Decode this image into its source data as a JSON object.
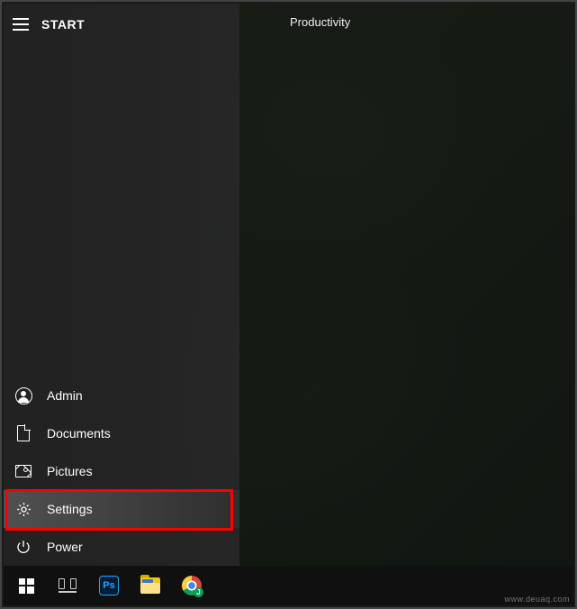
{
  "start": {
    "header": "START",
    "items": [
      {
        "label": "Admin",
        "icon": "user-icon"
      },
      {
        "label": "Documents",
        "icon": "document-icon"
      },
      {
        "label": "Pictures",
        "icon": "pictures-icon"
      },
      {
        "label": "Settings",
        "icon": "gear-icon"
      },
      {
        "label": "Power",
        "icon": "power-icon"
      }
    ],
    "highlighted_index": 3,
    "group_title": "Productivity"
  },
  "taskbar": {
    "items": [
      {
        "name": "start-button",
        "icon": "windows-logo-icon"
      },
      {
        "name": "task-view-button",
        "icon": "task-view-icon"
      },
      {
        "name": "photoshop-taskbar",
        "icon": "photoshop-icon",
        "badge": "Ps"
      },
      {
        "name": "file-explorer-taskbar",
        "icon": "folder-icon"
      },
      {
        "name": "chrome-taskbar",
        "icon": "chrome-icon",
        "badge": "J"
      }
    ]
  },
  "watermark": "www.deuaq.com"
}
